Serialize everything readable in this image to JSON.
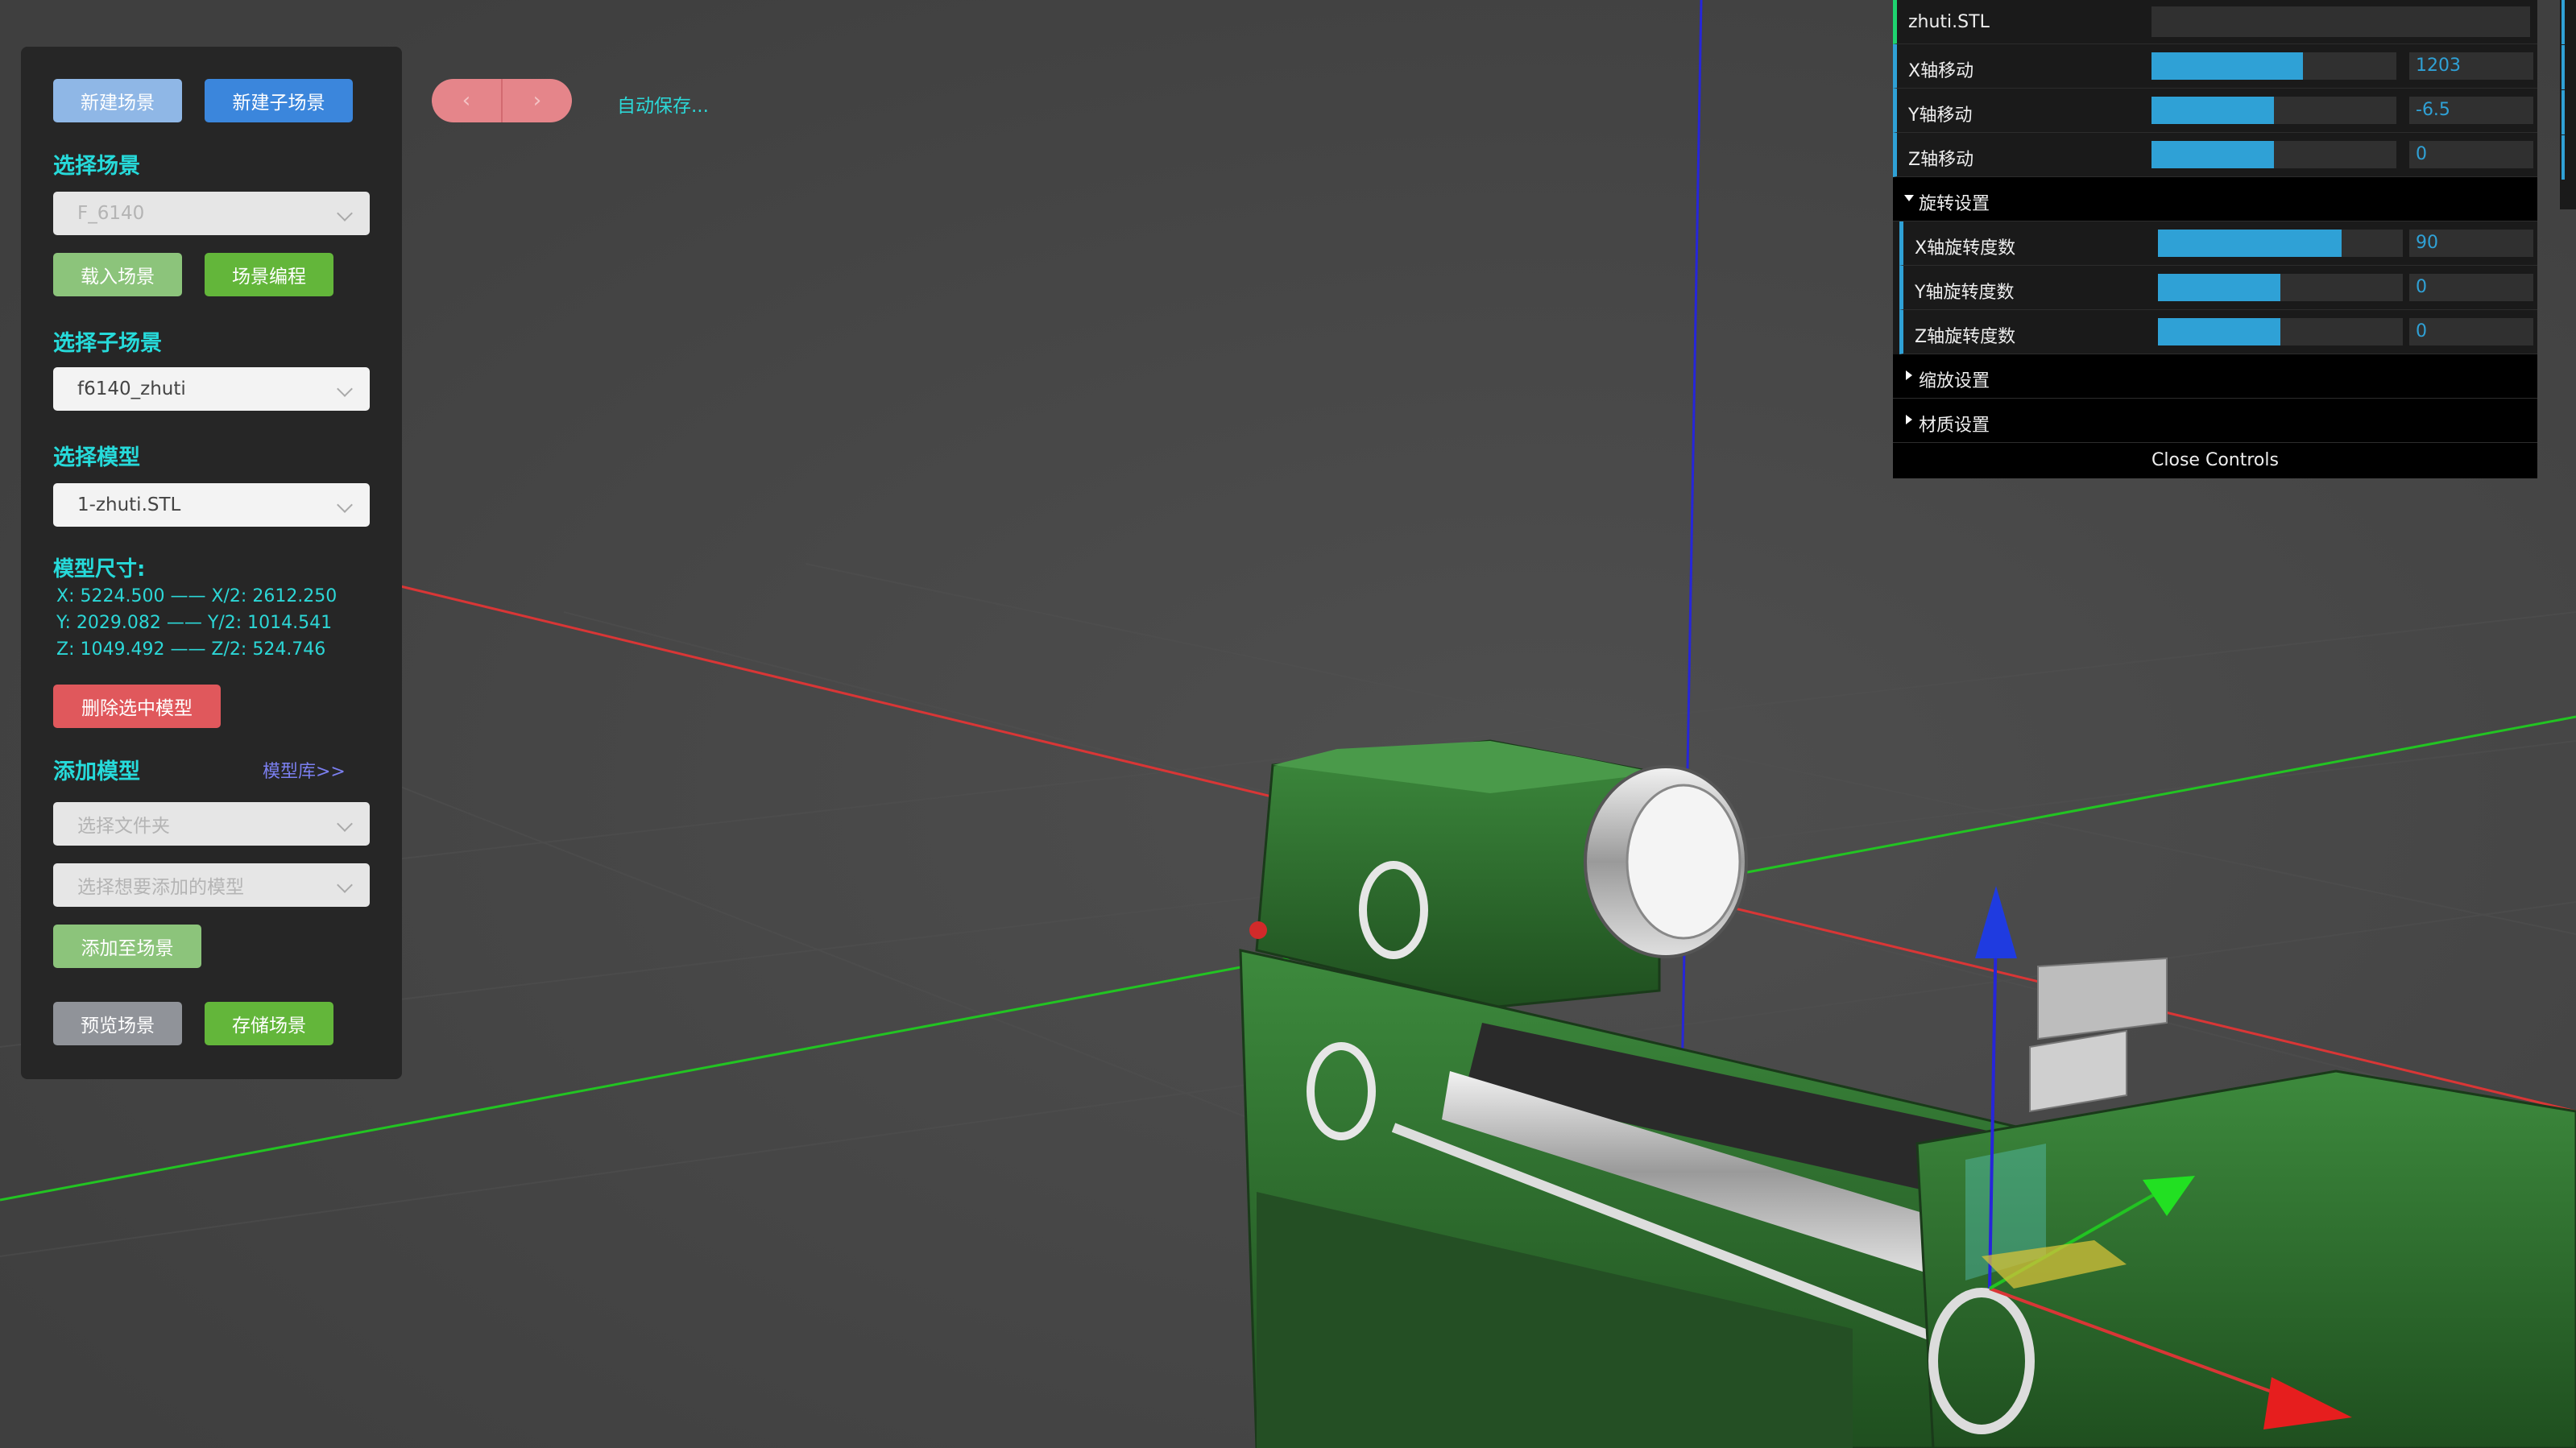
{
  "toolbar": {
    "new_scene": "新建场景",
    "new_subscene": "新建子场景",
    "autosave": "自动保存...",
    "nav_prev_icon": "chevron-left-icon",
    "nav_next_icon": "chevron-right-icon"
  },
  "scene": {
    "heading": "选择场景",
    "select_value": "F_6140",
    "load_button": "载入场景",
    "edit_button": "场景编程"
  },
  "subscene": {
    "heading": "选择子场景",
    "select_value": "f6140_zhuti"
  },
  "model": {
    "heading": "选择模型",
    "select_value": "1-zhuti.STL",
    "size_heading": "模型尺寸:",
    "dims": [
      "X: 5224.500 —— X/2: 2612.250",
      "Y: 2029.082 —— Y/2: 1014.541",
      "Z: 1049.492 —— Z/2: 524.746"
    ],
    "delete_button": "删除选中模型"
  },
  "add_model": {
    "heading": "添加模型",
    "library_link": "模型库>>",
    "folder_placeholder": "选择文件夹",
    "model_placeholder": "选择想要添加的模型",
    "add_button": "添加至场景"
  },
  "footer": {
    "preview_button": "预览场景",
    "save_button": "存储场景"
  },
  "gui": {
    "name_label": "zhuti.STL",
    "rows_move": [
      {
        "label": "X轴移动",
        "value": "1203",
        "fill": 0.62
      },
      {
        "label": "Y轴移动",
        "value": "-6.5",
        "fill": 0.5
      },
      {
        "label": "Z轴移动",
        "value": "0",
        "fill": 0.5
      }
    ],
    "rotation_folder": "旋转设置",
    "rows_rot": [
      {
        "label": "X轴旋转度数",
        "value": "90",
        "fill": 0.75
      },
      {
        "label": "Y轴旋转度数",
        "value": "0",
        "fill": 0.5
      },
      {
        "label": "Z轴旋转度数",
        "value": "0",
        "fill": 0.5
      }
    ],
    "scale_folder": "缩放设置",
    "material_folder": "材质设置",
    "close_controls": "Close Controls"
  },
  "colors": {
    "axis_x": "#d93636",
    "axis_y": "#22c422",
    "axis_z": "#2626d9",
    "machine_green": "#2e6b2e",
    "accent_cyan": "#26dada"
  }
}
